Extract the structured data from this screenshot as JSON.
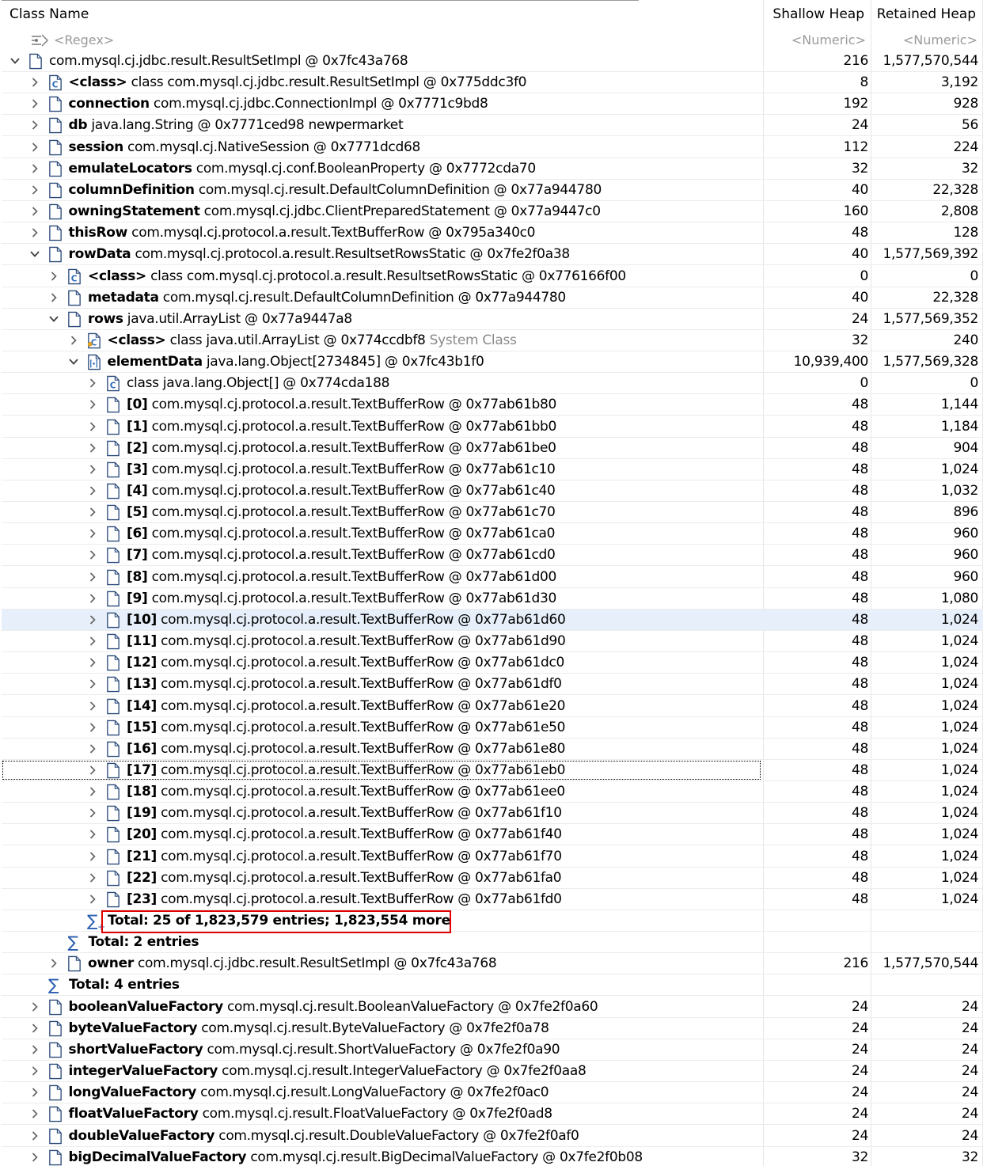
{
  "header": {
    "class_name": "Class Name",
    "shallow_heap": "Shallow Heap",
    "retained_heap": "Retained Heap"
  },
  "filter": {
    "name": "<Regex>",
    "shallow": "<Numeric>",
    "retained": "<Numeric>"
  },
  "colors": {
    "selected_row": "#e7f0fa",
    "highlight_box": "#e00000",
    "sigma": "#2a5db0",
    "muted_text": "#8a8a8a"
  },
  "rows": [
    {
      "depth": 0,
      "expanded": true,
      "icon": "object-icon",
      "field": "",
      "text": "com.mysql.cj.jdbc.result.ResultSetImpl @ 0x7fc43a768",
      "suffix": "",
      "shallow": "216",
      "retained": "1,577,570,544"
    },
    {
      "depth": 1,
      "expanded": false,
      "icon": "class-icon",
      "field": "<class>",
      "text": " class com.mysql.cj.jdbc.result.ResultSetImpl @ 0x775ddc3f0",
      "suffix": "",
      "shallow": "8",
      "retained": "3,192"
    },
    {
      "depth": 1,
      "expanded": false,
      "icon": "object-icon",
      "field": "connection",
      "text": " com.mysql.cj.jdbc.ConnectionImpl @ 0x7771c9bd8",
      "suffix": "",
      "shallow": "192",
      "retained": "928"
    },
    {
      "depth": 1,
      "expanded": false,
      "icon": "object-icon",
      "field": "db",
      "text": " java.lang.String @ 0x7771ced98  newpermarket",
      "suffix": "",
      "shallow": "24",
      "retained": "56"
    },
    {
      "depth": 1,
      "expanded": false,
      "icon": "object-icon",
      "field": "session",
      "text": " com.mysql.cj.NativeSession @ 0x7771dcd68",
      "suffix": "",
      "shallow": "112",
      "retained": "224"
    },
    {
      "depth": 1,
      "expanded": false,
      "icon": "object-icon",
      "field": "emulateLocators",
      "text": " com.mysql.cj.conf.BooleanProperty @ 0x7772cda70",
      "suffix": "",
      "shallow": "32",
      "retained": "32"
    },
    {
      "depth": 1,
      "expanded": false,
      "icon": "object-icon",
      "field": "columnDefinition",
      "text": " com.mysql.cj.result.DefaultColumnDefinition @ 0x77a944780",
      "suffix": "",
      "shallow": "40",
      "retained": "22,328"
    },
    {
      "depth": 1,
      "expanded": false,
      "icon": "object-icon",
      "field": "owningStatement",
      "text": " com.mysql.cj.jdbc.ClientPreparedStatement @ 0x77a9447c0",
      "suffix": "",
      "shallow": "160",
      "retained": "2,808"
    },
    {
      "depth": 1,
      "expanded": false,
      "icon": "object-icon",
      "field": "thisRow",
      "text": " com.mysql.cj.protocol.a.result.TextBufferRow @ 0x795a340c0",
      "suffix": "",
      "shallow": "48",
      "retained": "128"
    },
    {
      "depth": 1,
      "expanded": true,
      "icon": "object-icon",
      "field": "rowData",
      "text": " com.mysql.cj.protocol.a.result.ResultsetRowsStatic @ 0x7fe2f0a38",
      "suffix": "",
      "shallow": "40",
      "retained": "1,577,569,392"
    },
    {
      "depth": 2,
      "expanded": false,
      "icon": "class-icon",
      "field": "<class>",
      "text": " class com.mysql.cj.protocol.a.result.ResultsetRowsStatic @ 0x776166f00",
      "suffix": "",
      "shallow": "0",
      "retained": "0"
    },
    {
      "depth": 2,
      "expanded": false,
      "icon": "object-icon",
      "field": "metadata",
      "text": " com.mysql.cj.result.DefaultColumnDefinition @ 0x77a944780",
      "suffix": "",
      "shallow": "40",
      "retained": "22,328"
    },
    {
      "depth": 2,
      "expanded": true,
      "icon": "object-icon",
      "field": "rows",
      "text": " java.util.ArrayList @ 0x77a9447a8",
      "suffix": "",
      "shallow": "24",
      "retained": "1,577,569,352"
    },
    {
      "depth": 3,
      "expanded": false,
      "icon": "system-class-icon",
      "field": "<class>",
      "text": " class java.util.ArrayList @ 0x774ccdbf8",
      "suffix": " System Class",
      "shallow": "32",
      "retained": "240"
    },
    {
      "depth": 3,
      "expanded": true,
      "icon": "array-icon",
      "field": "elementData",
      "text": " java.lang.Object[2734845] @ 0x7fc43b1f0",
      "suffix": "",
      "shallow": "10,939,400",
      "retained": "1,577,569,328"
    },
    {
      "depth": 4,
      "expanded": false,
      "icon": "class-icon",
      "field": "",
      "text": " class java.lang.Object[] @ 0x774cda188",
      "suffix": "",
      "shallow": "0",
      "retained": "0"
    },
    {
      "depth": 4,
      "expanded": false,
      "icon": "object-icon",
      "field": "[0]",
      "text": " com.mysql.cj.protocol.a.result.TextBufferRow @ 0x77ab61b80",
      "suffix": "",
      "shallow": "48",
      "retained": "1,144"
    },
    {
      "depth": 4,
      "expanded": false,
      "icon": "object-icon",
      "field": "[1]",
      "text": " com.mysql.cj.protocol.a.result.TextBufferRow @ 0x77ab61bb0",
      "suffix": "",
      "shallow": "48",
      "retained": "1,184"
    },
    {
      "depth": 4,
      "expanded": false,
      "icon": "object-icon",
      "field": "[2]",
      "text": " com.mysql.cj.protocol.a.result.TextBufferRow @ 0x77ab61be0",
      "suffix": "",
      "shallow": "48",
      "retained": "904"
    },
    {
      "depth": 4,
      "expanded": false,
      "icon": "object-icon",
      "field": "[3]",
      "text": " com.mysql.cj.protocol.a.result.TextBufferRow @ 0x77ab61c10",
      "suffix": "",
      "shallow": "48",
      "retained": "1,024"
    },
    {
      "depth": 4,
      "expanded": false,
      "icon": "object-icon",
      "field": "[4]",
      "text": " com.mysql.cj.protocol.a.result.TextBufferRow @ 0x77ab61c40",
      "suffix": "",
      "shallow": "48",
      "retained": "1,032"
    },
    {
      "depth": 4,
      "expanded": false,
      "icon": "object-icon",
      "field": "[5]",
      "text": " com.mysql.cj.protocol.a.result.TextBufferRow @ 0x77ab61c70",
      "suffix": "",
      "shallow": "48",
      "retained": "896"
    },
    {
      "depth": 4,
      "expanded": false,
      "icon": "object-icon",
      "field": "[6]",
      "text": " com.mysql.cj.protocol.a.result.TextBufferRow @ 0x77ab61ca0",
      "suffix": "",
      "shallow": "48",
      "retained": "960"
    },
    {
      "depth": 4,
      "expanded": false,
      "icon": "object-icon",
      "field": "[7]",
      "text": " com.mysql.cj.protocol.a.result.TextBufferRow @ 0x77ab61cd0",
      "suffix": "",
      "shallow": "48",
      "retained": "960"
    },
    {
      "depth": 4,
      "expanded": false,
      "icon": "object-icon",
      "field": "[8]",
      "text": " com.mysql.cj.protocol.a.result.TextBufferRow @ 0x77ab61d00",
      "suffix": "",
      "shallow": "48",
      "retained": "960"
    },
    {
      "depth": 4,
      "expanded": false,
      "icon": "object-icon",
      "field": "[9]",
      "text": " com.mysql.cj.protocol.a.result.TextBufferRow @ 0x77ab61d30",
      "suffix": "",
      "shallow": "48",
      "retained": "1,080"
    },
    {
      "depth": 4,
      "expanded": false,
      "icon": "object-icon",
      "field": "[10]",
      "text": " com.mysql.cj.protocol.a.result.TextBufferRow @ 0x77ab61d60",
      "suffix": "",
      "shallow": "48",
      "retained": "1,024",
      "selected": true
    },
    {
      "depth": 4,
      "expanded": false,
      "icon": "object-icon",
      "field": "[11]",
      "text": " com.mysql.cj.protocol.a.result.TextBufferRow @ 0x77ab61d90",
      "suffix": "",
      "shallow": "48",
      "retained": "1,024"
    },
    {
      "depth": 4,
      "expanded": false,
      "icon": "object-icon",
      "field": "[12]",
      "text": " com.mysql.cj.protocol.a.result.TextBufferRow @ 0x77ab61dc0",
      "suffix": "",
      "shallow": "48",
      "retained": "1,024"
    },
    {
      "depth": 4,
      "expanded": false,
      "icon": "object-icon",
      "field": "[13]",
      "text": " com.mysql.cj.protocol.a.result.TextBufferRow @ 0x77ab61df0",
      "suffix": "",
      "shallow": "48",
      "retained": "1,024"
    },
    {
      "depth": 4,
      "expanded": false,
      "icon": "object-icon",
      "field": "[14]",
      "text": " com.mysql.cj.protocol.a.result.TextBufferRow @ 0x77ab61e20",
      "suffix": "",
      "shallow": "48",
      "retained": "1,024"
    },
    {
      "depth": 4,
      "expanded": false,
      "icon": "object-icon",
      "field": "[15]",
      "text": " com.mysql.cj.protocol.a.result.TextBufferRow @ 0x77ab61e50",
      "suffix": "",
      "shallow": "48",
      "retained": "1,024"
    },
    {
      "depth": 4,
      "expanded": false,
      "icon": "object-icon",
      "field": "[16]",
      "text": " com.mysql.cj.protocol.a.result.TextBufferRow @ 0x77ab61e80",
      "suffix": "",
      "shallow": "48",
      "retained": "1,024"
    },
    {
      "depth": 4,
      "expanded": false,
      "icon": "object-icon",
      "field": "[17]",
      "text": " com.mysql.cj.protocol.a.result.TextBufferRow @ 0x77ab61eb0",
      "suffix": "",
      "shallow": "48",
      "retained": "1,024",
      "focus": true
    },
    {
      "depth": 4,
      "expanded": false,
      "icon": "object-icon",
      "field": "[18]",
      "text": " com.mysql.cj.protocol.a.result.TextBufferRow @ 0x77ab61ee0",
      "suffix": "",
      "shallow": "48",
      "retained": "1,024"
    },
    {
      "depth": 4,
      "expanded": false,
      "icon": "object-icon",
      "field": "[19]",
      "text": " com.mysql.cj.protocol.a.result.TextBufferRow @ 0x77ab61f10",
      "suffix": "",
      "shallow": "48",
      "retained": "1,024"
    },
    {
      "depth": 4,
      "expanded": false,
      "icon": "object-icon",
      "field": "[20]",
      "text": " com.mysql.cj.protocol.a.result.TextBufferRow @ 0x77ab61f40",
      "suffix": "",
      "shallow": "48",
      "retained": "1,024"
    },
    {
      "depth": 4,
      "expanded": false,
      "icon": "object-icon",
      "field": "[21]",
      "text": " com.mysql.cj.protocol.a.result.TextBufferRow @ 0x77ab61f70",
      "suffix": "",
      "shallow": "48",
      "retained": "1,024"
    },
    {
      "depth": 4,
      "expanded": false,
      "icon": "object-icon",
      "field": "[22]",
      "text": " com.mysql.cj.protocol.a.result.TextBufferRow @ 0x77ab61fa0",
      "suffix": "",
      "shallow": "48",
      "retained": "1,024"
    },
    {
      "depth": 4,
      "expanded": false,
      "icon": "object-icon",
      "field": "[23]",
      "text": " com.mysql.cj.protocol.a.result.TextBufferRow @ 0x77ab61fd0",
      "suffix": "",
      "shallow": "48",
      "retained": "1,024"
    },
    {
      "depth": 4,
      "total": true,
      "more": true,
      "text": "Total: 25 of 1,823,579 entries; 1,823,554 more",
      "shallow": "",
      "retained": ""
    },
    {
      "depth": 3,
      "total": true,
      "text": "Total: 2 entries",
      "shallow": "",
      "retained": ""
    },
    {
      "depth": 2,
      "expanded": false,
      "icon": "object-icon",
      "field": "owner",
      "text": " com.mysql.cj.jdbc.result.ResultSetImpl @ 0x7fc43a768",
      "suffix": "",
      "shallow": "216",
      "retained": "1,577,570,544"
    },
    {
      "depth": 2,
      "total": true,
      "text": "Total: 4 entries",
      "shallow": "",
      "retained": ""
    },
    {
      "depth": 1,
      "expanded": false,
      "icon": "object-icon",
      "field": "booleanValueFactory",
      "text": " com.mysql.cj.result.BooleanValueFactory @ 0x7fe2f0a60",
      "suffix": "",
      "shallow": "24",
      "retained": "24"
    },
    {
      "depth": 1,
      "expanded": false,
      "icon": "object-icon",
      "field": "byteValueFactory",
      "text": " com.mysql.cj.result.ByteValueFactory @ 0x7fe2f0a78",
      "suffix": "",
      "shallow": "24",
      "retained": "24"
    },
    {
      "depth": 1,
      "expanded": false,
      "icon": "object-icon",
      "field": "shortValueFactory",
      "text": " com.mysql.cj.result.ShortValueFactory @ 0x7fe2f0a90",
      "suffix": "",
      "shallow": "24",
      "retained": "24"
    },
    {
      "depth": 1,
      "expanded": false,
      "icon": "object-icon",
      "field": "integerValueFactory",
      "text": " com.mysql.cj.result.IntegerValueFactory @ 0x7fe2f0aa8",
      "suffix": "",
      "shallow": "24",
      "retained": "24"
    },
    {
      "depth": 1,
      "expanded": false,
      "icon": "object-icon",
      "field": "longValueFactory",
      "text": " com.mysql.cj.result.LongValueFactory @ 0x7fe2f0ac0",
      "suffix": "",
      "shallow": "24",
      "retained": "24"
    },
    {
      "depth": 1,
      "expanded": false,
      "icon": "object-icon",
      "field": "floatValueFactory",
      "text": " com.mysql.cj.result.FloatValueFactory @ 0x7fe2f0ad8",
      "suffix": "",
      "shallow": "24",
      "retained": "24"
    },
    {
      "depth": 1,
      "expanded": false,
      "icon": "object-icon",
      "field": "doubleValueFactory",
      "text": " com.mysql.cj.result.DoubleValueFactory @ 0x7fe2f0af0",
      "suffix": "",
      "shallow": "24",
      "retained": "24"
    },
    {
      "depth": 1,
      "expanded": false,
      "icon": "object-icon",
      "field": "bigDecimalValueFactory",
      "text": " com.mysql.cj.result.BigDecimalValueFactory @ 0x7fe2f0b08",
      "suffix": "",
      "shallow": "32",
      "retained": "32"
    }
  ]
}
